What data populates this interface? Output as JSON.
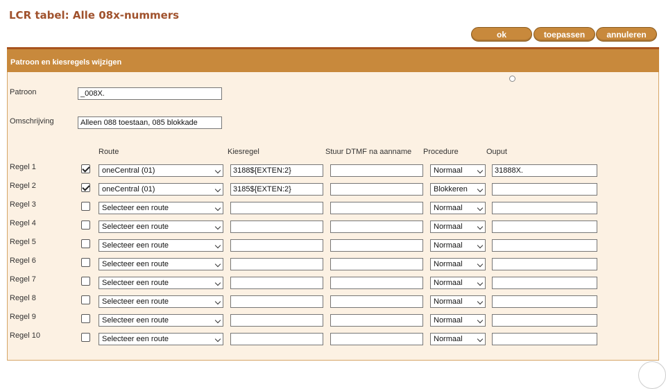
{
  "page": {
    "title": "LCR tabel: Alle 08x-nummers"
  },
  "toolbar": {
    "ok_label": "ok",
    "apply_label": "toepassen",
    "cancel_label": "annuleren"
  },
  "panel": {
    "header": "Patroon en kiesregels wijzigen"
  },
  "form": {
    "pattern_label": "Patroon",
    "pattern_value": "_008X.",
    "description_label": "Omschrijving",
    "description_value": "Alleen 088 toestaan, 085 blokkade"
  },
  "columns": {
    "route": "Route",
    "dial_rule": "Kiesregel",
    "dtmf": "Stuur DTMF na aanname",
    "procedure": "Procedure",
    "output": "Ouput"
  },
  "rules": [
    {
      "label": "Regel 1",
      "checked": true,
      "route": "oneCentral (01)",
      "dial_rule": "3188${EXTEN:2}",
      "dtmf": "",
      "procedure": "Normaal",
      "output": "31888X."
    },
    {
      "label": "Regel 2",
      "checked": true,
      "route": "oneCentral (01)",
      "dial_rule": "3185${EXTEN:2}",
      "dtmf": "",
      "procedure": "Blokkeren",
      "output": ""
    },
    {
      "label": "Regel 3",
      "checked": false,
      "route": "Selecteer een route",
      "dial_rule": "",
      "dtmf": "",
      "procedure": "Normaal",
      "output": ""
    },
    {
      "label": "Regel 4",
      "checked": false,
      "route": "Selecteer een route",
      "dial_rule": "",
      "dtmf": "",
      "procedure": "Normaal",
      "output": ""
    },
    {
      "label": "Regel 5",
      "checked": false,
      "route": "Selecteer een route",
      "dial_rule": "",
      "dtmf": "",
      "procedure": "Normaal",
      "output": ""
    },
    {
      "label": "Regel 6",
      "checked": false,
      "route": "Selecteer een route",
      "dial_rule": "",
      "dtmf": "",
      "procedure": "Normaal",
      "output": ""
    },
    {
      "label": "Regel 7",
      "checked": false,
      "route": "Selecteer een route",
      "dial_rule": "",
      "dtmf": "",
      "procedure": "Normaal",
      "output": ""
    },
    {
      "label": "Regel 8",
      "checked": false,
      "route": "Selecteer een route",
      "dial_rule": "",
      "dtmf": "",
      "procedure": "Normaal",
      "output": ""
    },
    {
      "label": "Regel 9",
      "checked": false,
      "route": "Selecteer een route",
      "dial_rule": "",
      "dtmf": "",
      "procedure": "Normaal",
      "output": ""
    },
    {
      "label": "Regel 10",
      "checked": false,
      "route": "Selecteer een route",
      "dial_rule": "",
      "dtmf": "",
      "procedure": "Normaal",
      "output": ""
    }
  ],
  "colors": {
    "accent": "#c8893c",
    "title": "#a0522d",
    "panel_bg": "#fcf1e3"
  }
}
